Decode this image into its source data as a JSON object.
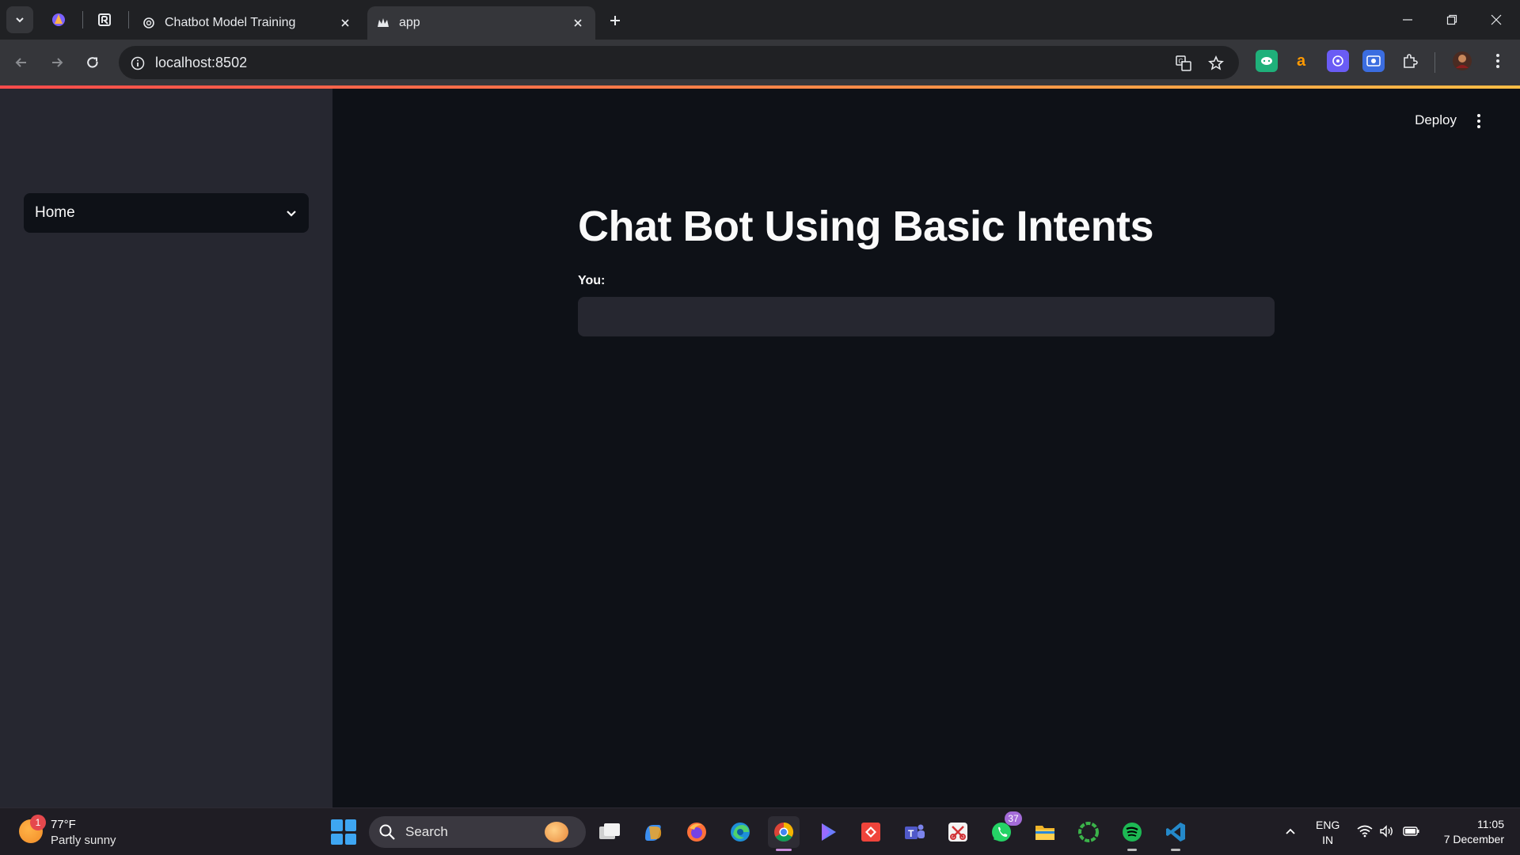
{
  "browser": {
    "tabs": [
      {
        "title": "Chatbot Model Training",
        "active": false
      },
      {
        "title": "app",
        "active": true
      }
    ],
    "url": "localhost:8502"
  },
  "sidebar": {
    "select": {
      "value": "Home"
    }
  },
  "header": {
    "deploy_label": "Deploy"
  },
  "main": {
    "title": "Chat Bot Using Basic Intents",
    "input": {
      "label": "You:",
      "value": ""
    }
  },
  "taskbar": {
    "weather": {
      "temp": "77°F",
      "condition": "Partly sunny",
      "badge": "1"
    },
    "search_label": "Search",
    "whatsapp_badge": "37",
    "language": {
      "line1": "ENG",
      "line2": "IN"
    },
    "clock": {
      "time": "11:05",
      "date": "7 December"
    }
  },
  "colors": {
    "app_bg": "#0e1117",
    "sidebar_bg": "#262730",
    "accent_start": "#ff4b4b",
    "accent_end": "#ffbd45"
  }
}
